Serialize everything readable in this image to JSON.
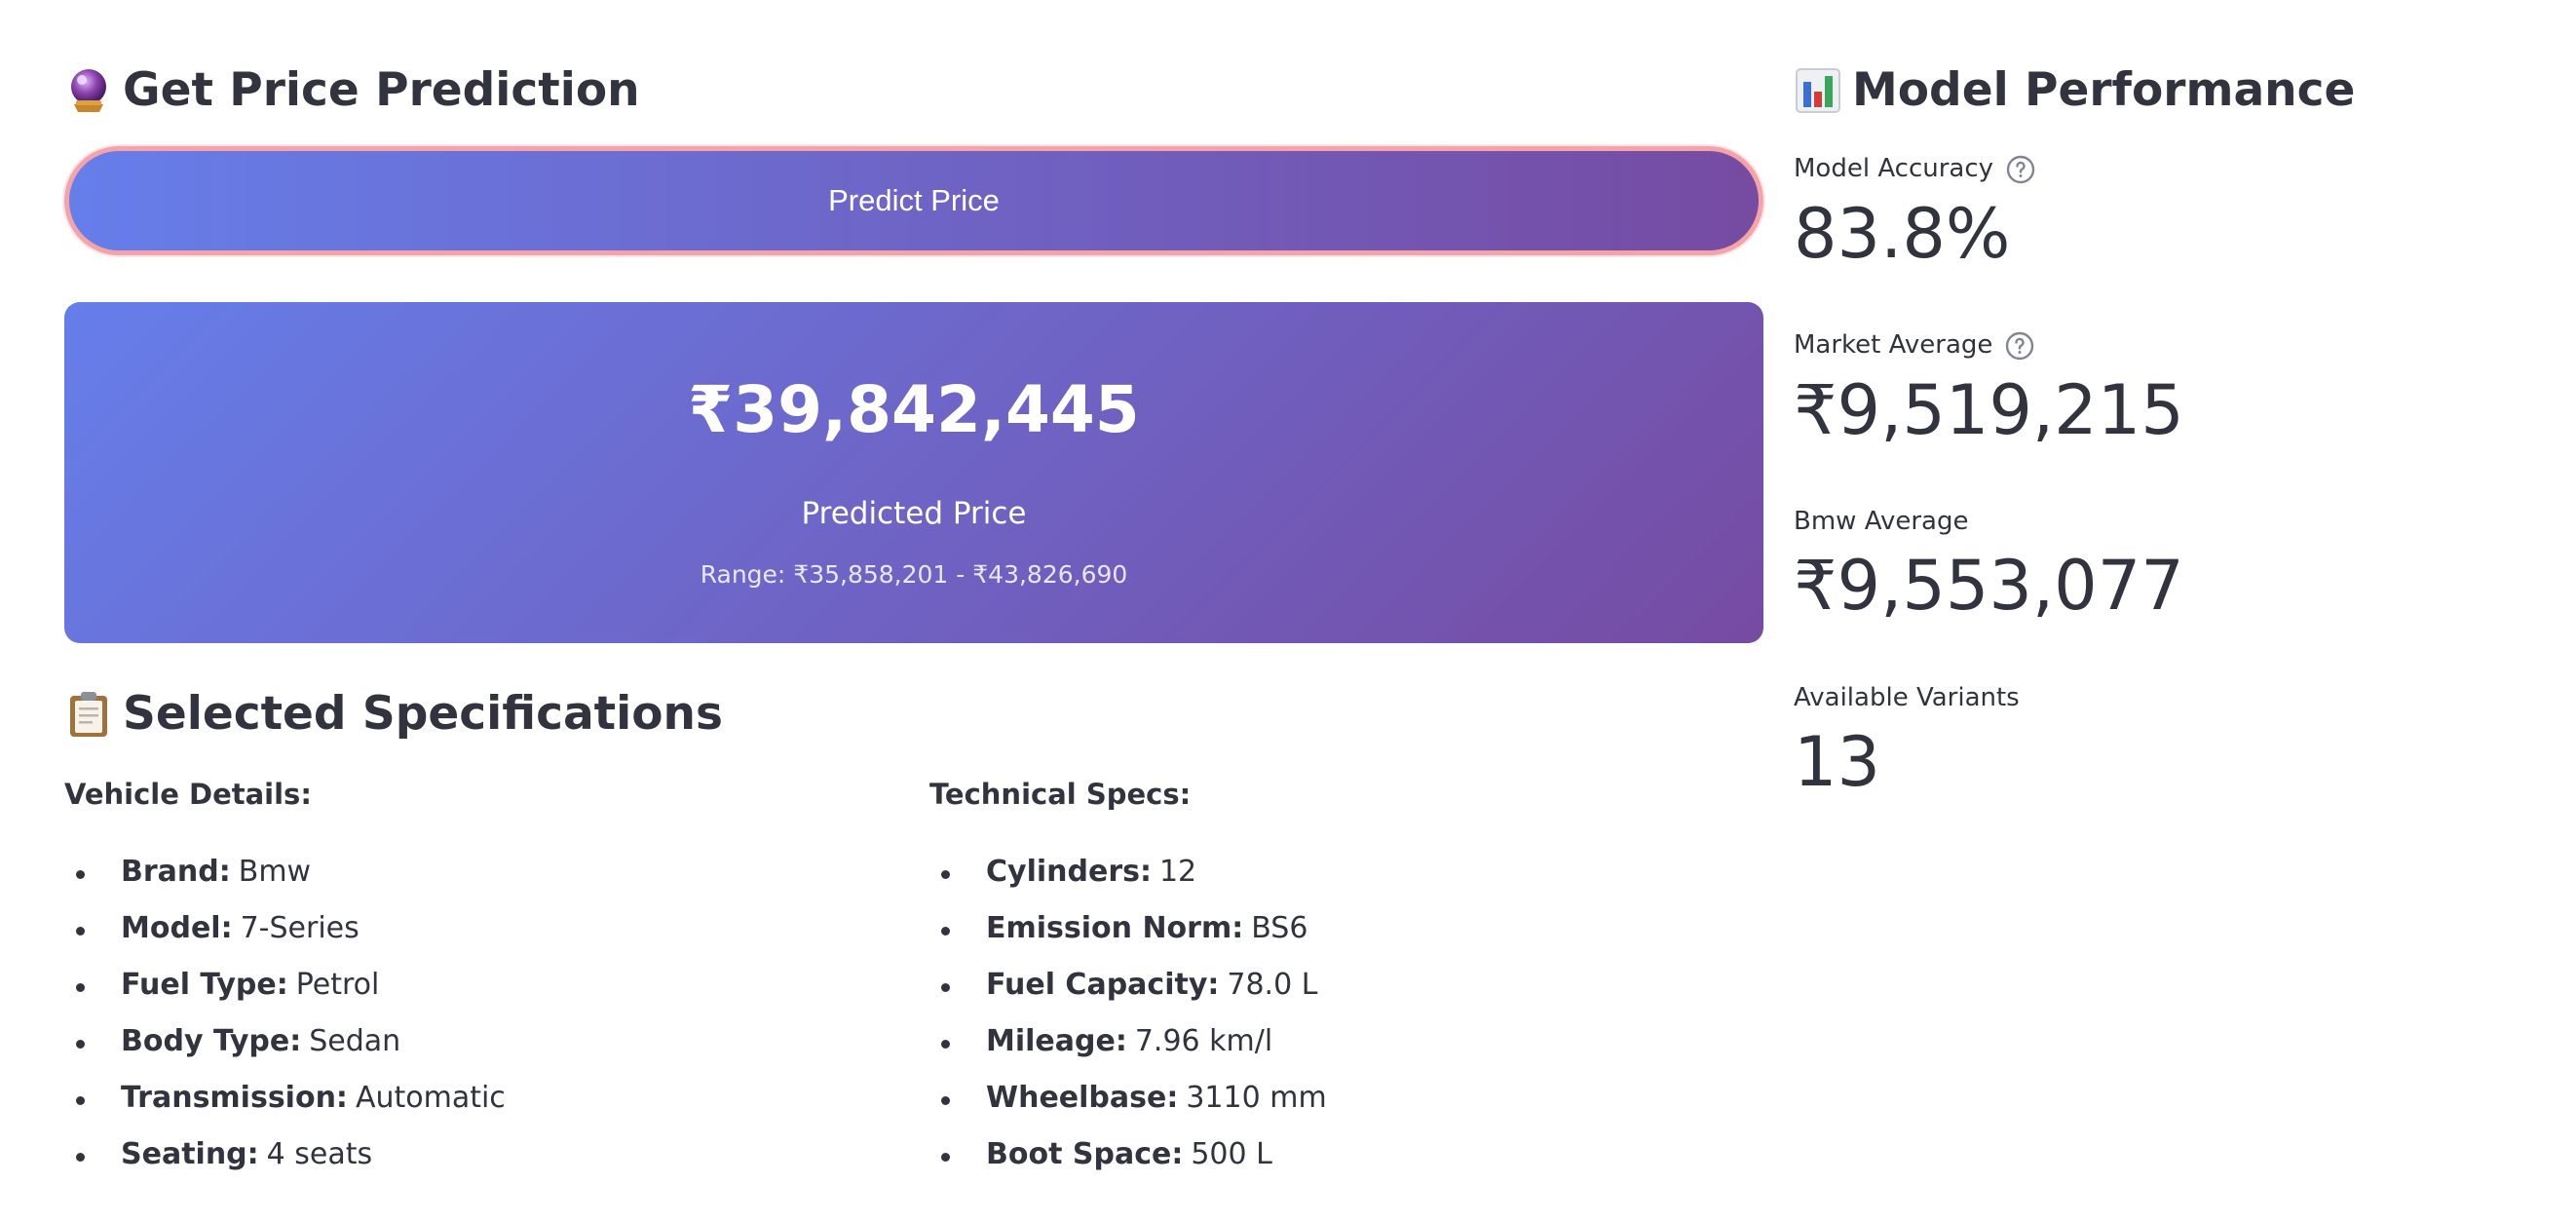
{
  "prediction": {
    "title": "Get Price Prediction",
    "button_label": "Predict Price",
    "predicted_price": "₹39,842,445",
    "predicted_label": "Predicted Price",
    "range_text": "Range: ₹35,858,201 - ₹43,826,690",
    "icon": "crystal-ball-icon"
  },
  "specs": {
    "title": "Selected Specifications",
    "icon": "clipboard-icon",
    "vehicle": {
      "heading": "Vehicle Details:",
      "items": [
        {
          "key": "Brand:",
          "value": "Bmw"
        },
        {
          "key": "Model:",
          "value": "7-Series"
        },
        {
          "key": "Fuel Type:",
          "value": "Petrol"
        },
        {
          "key": "Body Type:",
          "value": "Sedan"
        },
        {
          "key": "Transmission:",
          "value": "Automatic"
        },
        {
          "key": "Seating:",
          "value": "4 seats"
        }
      ]
    },
    "technical": {
      "heading": "Technical Specs:",
      "items": [
        {
          "key": "Cylinders:",
          "value": "12"
        },
        {
          "key": "Emission Norm:",
          "value": "BS6"
        },
        {
          "key": "Fuel Capacity:",
          "value": "78.0 L"
        },
        {
          "key": "Mileage:",
          "value": "7.96 km/l"
        },
        {
          "key": "Wheelbase:",
          "value": "3110 mm"
        },
        {
          "key": "Boot Space:",
          "value": "500 L"
        }
      ]
    }
  },
  "performance": {
    "title": "Model Performance",
    "icon": "bar-chart-icon",
    "metrics": [
      {
        "label": "Model Accuracy",
        "value": "83.8%",
        "help": true
      },
      {
        "label": "Market Average",
        "value": "₹9,519,215",
        "help": true
      },
      {
        "label": "Bmw Average",
        "value": "₹9,553,077",
        "help": false
      },
      {
        "label": "Available Variants",
        "value": "13",
        "help": false
      }
    ]
  },
  "colors": {
    "gradient_start": "#667eea",
    "gradient_end": "#764ba2",
    "text": "#31333f",
    "button_border": "#f4a4a8"
  }
}
